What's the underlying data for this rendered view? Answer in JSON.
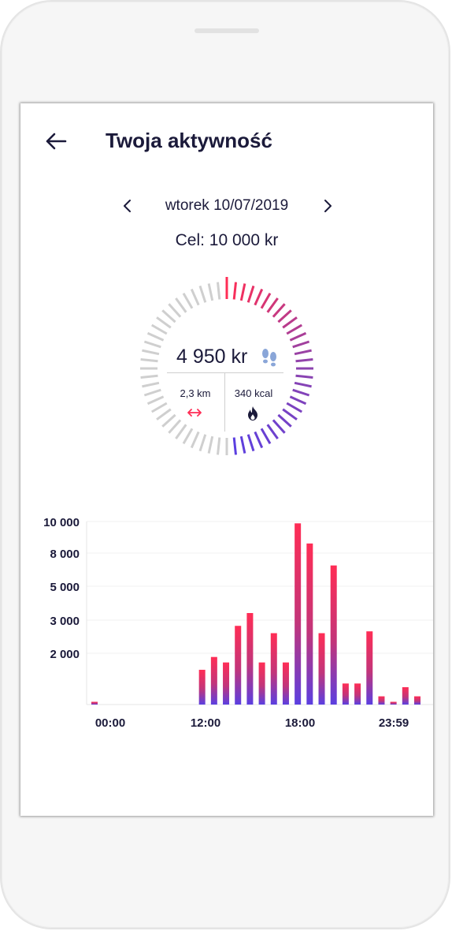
{
  "header": {
    "title": "Twoja aktywność",
    "back_icon": "arrow-left-icon"
  },
  "date_nav": {
    "label": "wtorek 10/07/2019",
    "prev_icon": "chevron-left-icon",
    "next_icon": "chevron-right-icon"
  },
  "goal": {
    "label": "Cel: 10 000 kr"
  },
  "summary": {
    "steps": "4 950 kr",
    "steps_icon": "footprints-icon",
    "distance": "2,3 km",
    "distance_icon": "double-arrow-icon",
    "calories": "340 kcal",
    "calories_icon": "flame-icon",
    "progress_fraction": 0.495
  },
  "colors": {
    "accent_red": "#ff2d55",
    "accent_purple": "#8e44ad",
    "accent_violet": "#5b3fe0",
    "ring_inactive": "#cfcfcf",
    "text_dark": "#1b1a3a"
  },
  "chart_data": {
    "type": "bar",
    "y_tick_labels": [
      "10 000",
      "8 000",
      "5 000",
      "3 000",
      "2 000"
    ],
    "x_tick_labels": [
      "00:00",
      "12:00",
      "18:00",
      "23:59"
    ],
    "values": [
      150,
      0,
      0,
      0,
      0,
      0,
      0,
      0,
      0,
      1900,
      2600,
      2300,
      4300,
      5000,
      2300,
      3900,
      2300,
      9900,
      8800,
      3900,
      7600,
      1150,
      1150,
      4000,
      450,
      150,
      950,
      450
    ],
    "grid": true
  }
}
